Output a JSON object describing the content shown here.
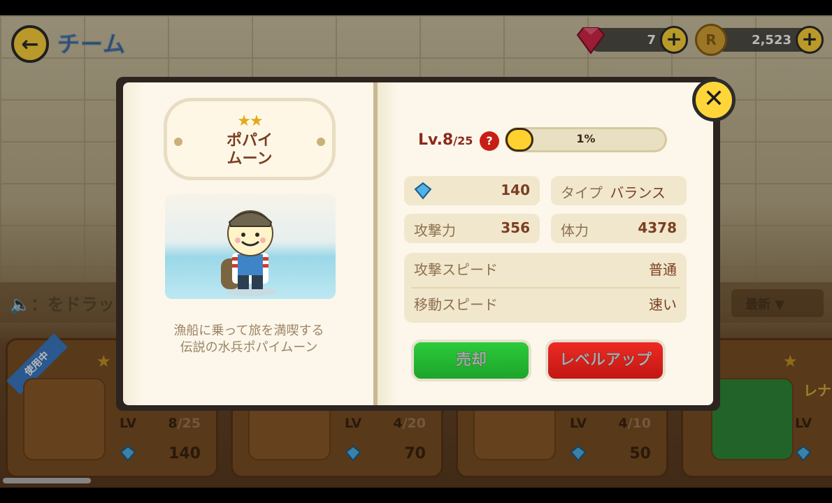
{
  "header": {
    "title": "チーム",
    "gems": "7",
    "coins": "2,523"
  },
  "background": {
    "drag_hint": "：をドラック",
    "sort_label": "最新",
    "cards": [
      {
        "badge": "使用中",
        "lv_label": "LV",
        "lv_value": "8",
        "lv_max": "/25",
        "cost": "140"
      },
      {
        "lv_label": "LV",
        "lv_value": "4",
        "lv_max": "/20",
        "cost": "70"
      },
      {
        "lv_label": "LV",
        "lv_value": "4",
        "lv_max": "/10",
        "cost": "50"
      },
      {
        "lv_label": "LV",
        "side_text": "レナ"
      }
    ]
  },
  "character": {
    "stars": 2,
    "name_line1": "ポパイ",
    "name_line2": "ムーン",
    "description_line1": "漁船に乗って旅を満喫する",
    "description_line2": "伝説の水兵ポパイムーン"
  },
  "stats": {
    "level_label": "Lv.8",
    "level_max": "/25",
    "help": "?",
    "xp_percent_label": "1%",
    "xp_fraction": 0.01,
    "cost": "140",
    "type_label": "タイプ",
    "type_value": "バランス",
    "attack_label": "攻撃力",
    "attack_value": "356",
    "hp_label": "体力",
    "hp_value": "4378",
    "attack_speed_label": "攻撃スピード",
    "attack_speed_value": "普通",
    "move_speed_label": "移動スピード",
    "move_speed_value": "速い"
  },
  "buttons": {
    "sell": "売却",
    "level_up": "レベルアップ",
    "close": "✕"
  },
  "colors": {
    "accent_yellow": "#ffd53a",
    "sell_green": "#1ea42a",
    "levelup_red": "#c11712",
    "text_brown": "#7a3e22"
  }
}
